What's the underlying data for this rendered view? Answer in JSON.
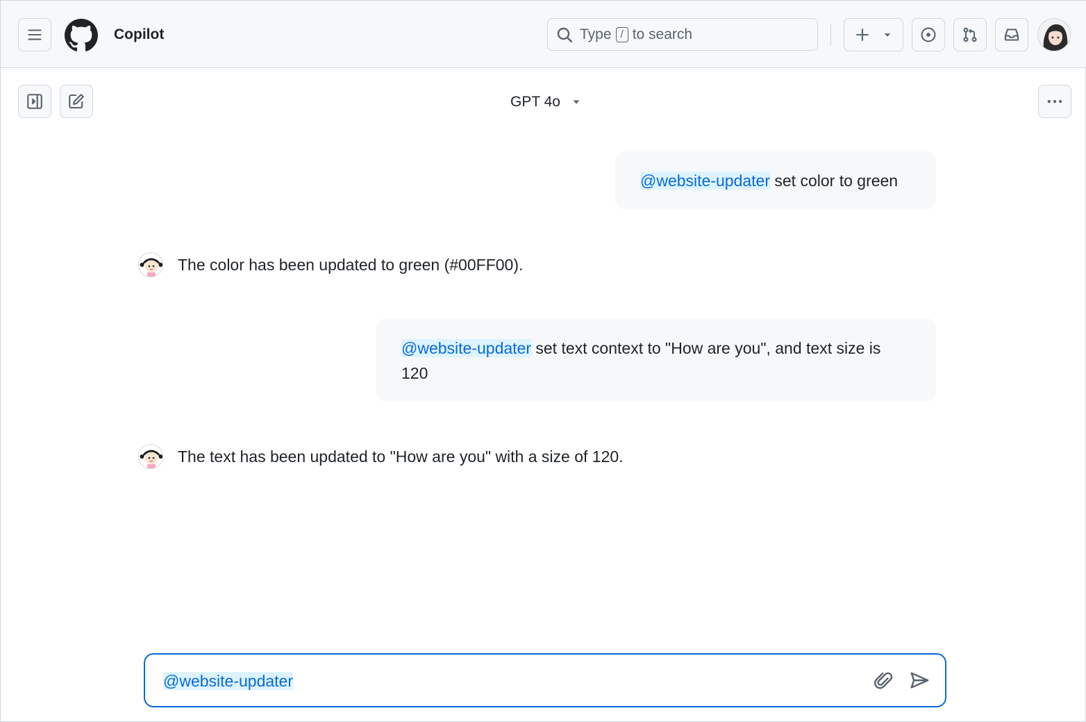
{
  "header": {
    "app_title": "Copilot",
    "search_prefix": "Type",
    "search_key": "/",
    "search_suffix": "to search",
    "icons": [
      "menu-icon",
      "github-logo",
      "search-icon",
      "plus-icon",
      "chevron-down-icon",
      "issue-icon",
      "pull-request-icon",
      "inbox-icon",
      "user-avatar"
    ]
  },
  "toolbar": {
    "model": "GPT 4o",
    "icons": [
      "sidebar-toggle-icon",
      "new-chat-icon",
      "kebab-icon"
    ]
  },
  "messages": [
    {
      "role": "user",
      "mention": "@website-updater",
      "text": " set color to green"
    },
    {
      "role": "assistant",
      "text": "The color has been updated to green (#00FF00)."
    },
    {
      "role": "user",
      "mention": "@website-updater",
      "text": " set text context to \"How are you\", and text size is 120"
    },
    {
      "role": "assistant",
      "text": "The text has been updated to \"How are you\" with a size of 120."
    }
  ],
  "composer": {
    "value": "@website-updater",
    "icons": [
      "paperclip-icon",
      "send-icon"
    ]
  },
  "colors": {
    "accent": "#0969da",
    "mention_bg": "#ddf4ff",
    "bubble_bg": "#f6f8fa",
    "header_bg": "#f6f8fa",
    "border": "#d0d7de"
  }
}
